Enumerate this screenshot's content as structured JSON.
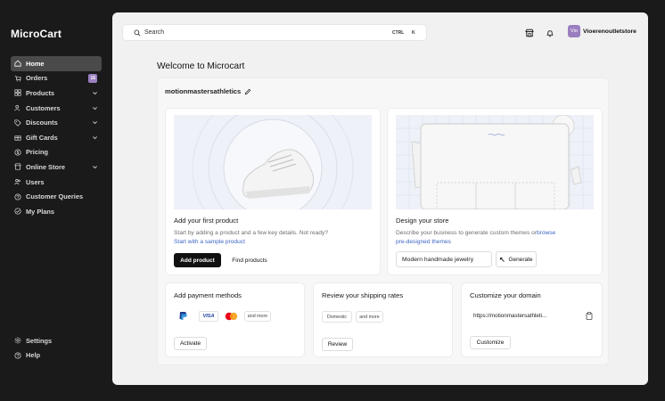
{
  "app": {
    "brand": "MicroCart"
  },
  "sidebar": {
    "items": [
      {
        "label": "Home"
      },
      {
        "label": "Orders",
        "badge": "16"
      },
      {
        "label": "Products"
      },
      {
        "label": "Customers"
      },
      {
        "label": "Discounts"
      },
      {
        "label": "Gift Cards"
      },
      {
        "label": "Pricing"
      },
      {
        "label": "Online Store"
      },
      {
        "label": "Users"
      },
      {
        "label": "Customer Queries"
      },
      {
        "label": "My Plans"
      }
    ],
    "bottom": [
      {
        "label": "Settings"
      },
      {
        "label": "Help"
      }
    ]
  },
  "header": {
    "search_placeholder": "Search",
    "shortcut_ctrl": "CTRL",
    "shortcut_key": "K",
    "avatar_initials": "Vio",
    "store_name": "Vioerenoutletstore"
  },
  "main": {
    "welcome": "Welcome to Microcart",
    "store_title": "motionmastersathletics",
    "product_card": {
      "title": "Add your first product",
      "desc": "Start by adding a product and a few key details. Not ready?",
      "link": "Start with a sample product",
      "primary": "Add product",
      "secondary": "Find products"
    },
    "design_card": {
      "title": "Design your store",
      "desc": "Describe your business to generate custom themes or",
      "link": "browse pre-designed themes",
      "input_value": "Modern handmade jewelry",
      "generate": "Generate"
    },
    "payment_card": {
      "title": "Add payment methods",
      "visa": "VISA",
      "more": "and more",
      "button": "Activate"
    },
    "shipping_card": {
      "title": "Review your shipping rates",
      "chip1": "Domestic",
      "chip2": "and more",
      "button": "Review"
    },
    "domain_card": {
      "title": "Customize your domain",
      "domain": "https://motionmastersathleti...",
      "button": "Customize"
    }
  },
  "colors": {
    "accent": "#9a7fc0",
    "link": "#3b66c4",
    "dark": "#111111"
  }
}
